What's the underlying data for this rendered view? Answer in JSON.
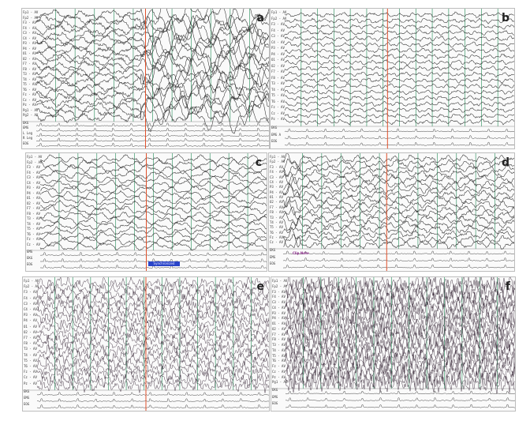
{
  "panels": [
    {
      "id": "a",
      "letter": "a",
      "channels": [
        "Fp1 - AV",
        "Fp2 - AV",
        "F3 - AV",
        "F4 - AV",
        "C3 - AV",
        "C4 - AV",
        "P3 - AV",
        "P4 - AV",
        "O1 - AV",
        "O2 - AV",
        "F7 - AV",
        "F8 - AV",
        "T3 - AV",
        "T4 - AV",
        "T5 - AV",
        "T6 - AV",
        "Fz - AV",
        "Cz - AV",
        "Pz - AV",
        "Pg1 - AV",
        "Pg2 - AV"
      ],
      "bottom": [
        "EKG",
        "EMG",
        "L Leg",
        "R Leg",
        "EOG"
      ]
    },
    {
      "id": "b",
      "letter": "b",
      "channels": [
        "Fp1 - AV",
        "Fp2 - AV",
        "F3 - AV",
        "F4 - AV",
        "C3 - AV",
        "C4 - AV",
        "P3 - AV",
        "P4 - AV",
        "O1 - AV",
        "O2 - AV",
        "F7 - AV",
        "F8 - AV",
        "T3 - AV",
        "T4 - AV",
        "T5 - AV",
        "T6 - AV",
        "Fz - AV",
        "Cz - AV",
        "Pz - AV"
      ],
      "bottom": [
        "EKG",
        "EMG A",
        "EOG"
      ]
    },
    {
      "id": "c",
      "letter": "c",
      "channels": [
        "Fp1 - AV",
        "Fp2 - AV",
        "F3 - AV",
        "F4 - AV",
        "C3 - AV",
        "C4 - AV",
        "P3 - AV",
        "P4 - AV",
        "O1 - AV",
        "O2 - AV",
        "F7 - AV",
        "F8 - AV",
        "T3 - AV",
        "T4 - AV",
        "T5 - AV",
        "T6 - AV",
        "Fz - AV",
        "Cz - AV"
      ],
      "bottom": [
        "EMG",
        "EKG",
        "EOG"
      ],
      "annotation": "Synchronized"
    },
    {
      "id": "d",
      "letter": "d",
      "channels": [
        "Fp1 - AV",
        "Fp2 - AV",
        "F3 - AV",
        "F4 - AV",
        "C3 - AV",
        "C4 - AV",
        "P3 - AV",
        "P4 - AV",
        "O1 - AV",
        "O2 - AV",
        "F7 - AV",
        "F8 - AV",
        "T3 - AV",
        "T4 - AV",
        "T5 - AV",
        "T6 - AV",
        "Fz - AV",
        "Cz - AV"
      ],
      "bottom": [
        "EKG",
        "EMG",
        "EOG"
      ],
      "annotation": "Clip Note"
    },
    {
      "id": "e",
      "letter": "e",
      "channels": [
        "Fp1 - AV",
        "Fp2 - AV",
        "F3 - AV",
        "F4 - AV",
        "C3 - AV",
        "C4 - AV",
        "P3 - AV",
        "P4 - AV",
        "O1 - AV",
        "O2 - AV",
        "F7 - AV",
        "F8 - AV",
        "T3 - AV",
        "T4 - AV",
        "T5 - AV",
        "T6 - AV",
        "Fz - AV",
        "Cz - AV",
        "Pz - AV"
      ],
      "bottom": [
        "EKG",
        "EMG",
        "EOG"
      ]
    },
    {
      "id": "f",
      "letter": "f",
      "channels": [
        "Fp1 - AV",
        "Fp2 - AV",
        "F3 - AV",
        "F4 - AV",
        "C3 - AV",
        "C4 - AV",
        "P3 - AV",
        "P4 - AV",
        "O1 - AV",
        "O2 - AV",
        "F7 - AV",
        "F8 - AV",
        "T3 - AV",
        "T4 - AV",
        "T5 - AV",
        "T6 - AV",
        "Fz - AV",
        "Cz - AV",
        "Pz - AV",
        "Pg1 - AV"
      ],
      "bottom": [
        "EKG",
        "EMG",
        "EOG"
      ]
    }
  ],
  "colors": {
    "trace": "#2b2b2b",
    "trace_dense": "#3a2a3a",
    "grid": "#3c9a6a",
    "marker": "#e0502a",
    "annotation_bg": "#2a45c8",
    "annotation_text": "#e8e8ff",
    "clip_note": "#8a2a8a"
  }
}
